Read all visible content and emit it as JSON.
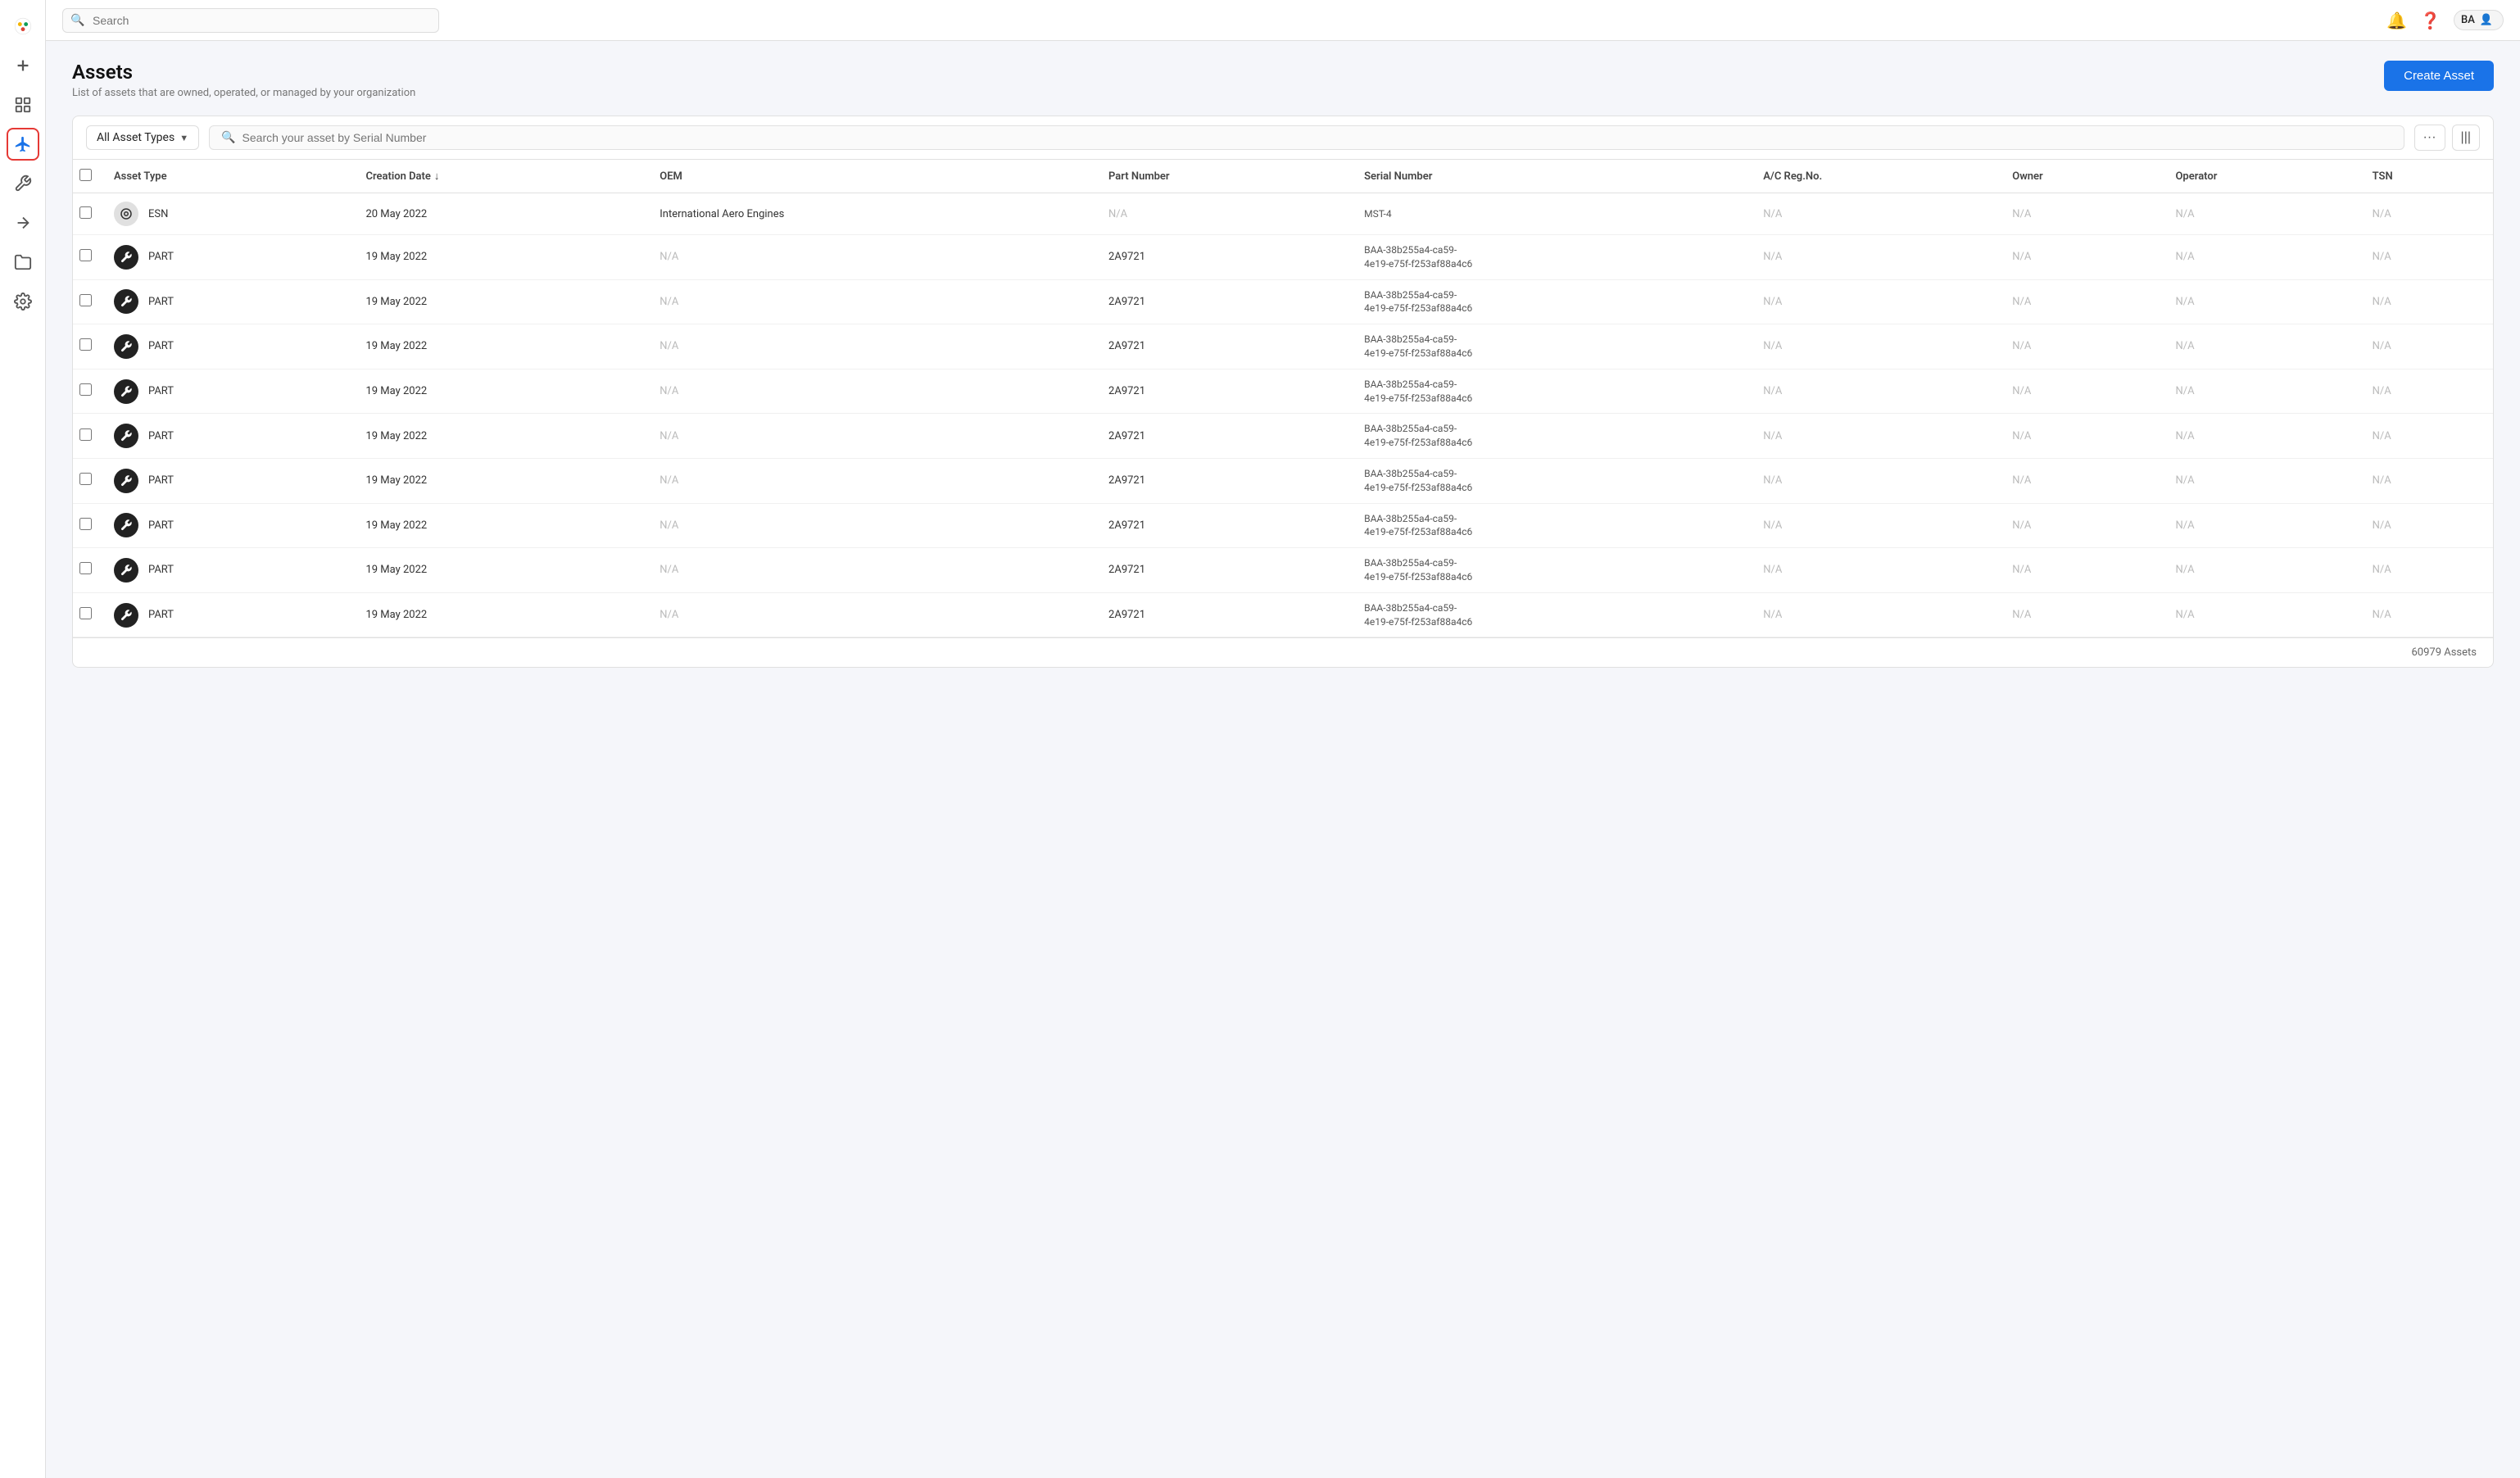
{
  "app": {
    "title": "Assets"
  },
  "topbar": {
    "search_placeholder": "Search",
    "user_initials": "BA"
  },
  "sidebar": {
    "items": [
      {
        "id": "add",
        "icon": "plus",
        "label": "Add"
      },
      {
        "id": "dashboard",
        "icon": "bar-chart",
        "label": "Dashboard"
      },
      {
        "id": "assets",
        "icon": "plane",
        "label": "Assets",
        "active": true
      },
      {
        "id": "tools",
        "icon": "tool",
        "label": "Tools"
      },
      {
        "id": "wrench",
        "icon": "wrench",
        "label": "Wrench"
      },
      {
        "id": "folder",
        "icon": "folder",
        "label": "Folder"
      },
      {
        "id": "settings",
        "icon": "settings",
        "label": "Settings"
      }
    ]
  },
  "page": {
    "title": "Assets",
    "subtitle": "List of assets that are owned, operated, or managed by your organization",
    "create_button": "Create Asset"
  },
  "filter": {
    "asset_type_label": "All Asset Types",
    "search_placeholder": "Search your asset by Serial Number",
    "more_icon": "···",
    "columns_icon": "|||"
  },
  "table": {
    "columns": [
      {
        "id": "asset_type",
        "label": "Asset Type"
      },
      {
        "id": "creation_date",
        "label": "Creation Date",
        "sortable": true
      },
      {
        "id": "oem",
        "label": "OEM"
      },
      {
        "id": "part_number",
        "label": "Part Number"
      },
      {
        "id": "serial_number",
        "label": "Serial Number"
      },
      {
        "id": "ac_reg_no",
        "label": "A/C Reg.No."
      },
      {
        "id": "owner",
        "label": "Owner"
      },
      {
        "id": "operator",
        "label": "Operator"
      },
      {
        "id": "tsn",
        "label": "TSN"
      }
    ],
    "rows": [
      {
        "type": "ESN",
        "icon_type": "esn",
        "creation_date": "20 May 2022",
        "oem": "International Aero Engines",
        "part_number": "N/A",
        "serial_number": "MST-4",
        "ac_reg_no": "N/A",
        "owner": "N/A",
        "operator": "N/A",
        "tsn": "N/A"
      },
      {
        "type": "PART",
        "icon_type": "part",
        "creation_date": "19 May 2022",
        "oem": "N/A",
        "part_number": "2A9721",
        "serial_number": "BAA-38b255a4-ca59-\n4e19-e75f-f253af88a4c6",
        "ac_reg_no": "N/A",
        "owner": "N/A",
        "operator": "N/A",
        "tsn": "N/A"
      },
      {
        "type": "PART",
        "icon_type": "part",
        "creation_date": "19 May 2022",
        "oem": "N/A",
        "part_number": "2A9721",
        "serial_number": "BAA-38b255a4-ca59-\n4e19-e75f-f253af88a4c6",
        "ac_reg_no": "N/A",
        "owner": "N/A",
        "operator": "N/A",
        "tsn": "N/A"
      },
      {
        "type": "PART",
        "icon_type": "part",
        "creation_date": "19 May 2022",
        "oem": "N/A",
        "part_number": "2A9721",
        "serial_number": "BAA-38b255a4-ca59-\n4e19-e75f-f253af88a4c6",
        "ac_reg_no": "N/A",
        "owner": "N/A",
        "operator": "N/A",
        "tsn": "N/A"
      },
      {
        "type": "PART",
        "icon_type": "part",
        "creation_date": "19 May 2022",
        "oem": "N/A",
        "part_number": "2A9721",
        "serial_number": "BAA-38b255a4-ca59-\n4e19-e75f-f253af88a4c6",
        "ac_reg_no": "N/A",
        "owner": "N/A",
        "operator": "N/A",
        "tsn": "N/A"
      },
      {
        "type": "PART",
        "icon_type": "part",
        "creation_date": "19 May 2022",
        "oem": "N/A",
        "part_number": "2A9721",
        "serial_number": "BAA-38b255a4-ca59-\n4e19-e75f-f253af88a4c6",
        "ac_reg_no": "N/A",
        "owner": "N/A",
        "operator": "N/A",
        "tsn": "N/A"
      },
      {
        "type": "PART",
        "icon_type": "part",
        "creation_date": "19 May 2022",
        "oem": "N/A",
        "part_number": "2A9721",
        "serial_number": "BAA-38b255a4-ca59-\n4e19-e75f-f253af88a4c6",
        "ac_reg_no": "N/A",
        "owner": "N/A",
        "operator": "N/A",
        "tsn": "N/A"
      },
      {
        "type": "PART",
        "icon_type": "part",
        "creation_date": "19 May 2022",
        "oem": "N/A",
        "part_number": "2A9721",
        "serial_number": "BAA-38b255a4-ca59-\n4e19-e75f-f253af88a4c6",
        "ac_reg_no": "N/A",
        "owner": "N/A",
        "operator": "N/A",
        "tsn": "N/A"
      },
      {
        "type": "PART",
        "icon_type": "part",
        "creation_date": "19 May 2022",
        "oem": "N/A",
        "part_number": "2A9721",
        "serial_number": "BAA-38b255a4-ca59-\n4e19-e75f-f253af88a4c6",
        "ac_reg_no": "N/A",
        "owner": "N/A",
        "operator": "N/A",
        "tsn": "N/A"
      },
      {
        "type": "PART",
        "icon_type": "part",
        "creation_date": "19 May 2022",
        "oem": "N/A",
        "part_number": "2A9721",
        "serial_number": "BAA-38b255a4-ca59-\n4e19-e75f-f253af88a4c6",
        "ac_reg_no": "N/A",
        "owner": "N/A",
        "operator": "N/A",
        "tsn": "N/A"
      }
    ],
    "total_assets": "60979 Assets"
  }
}
